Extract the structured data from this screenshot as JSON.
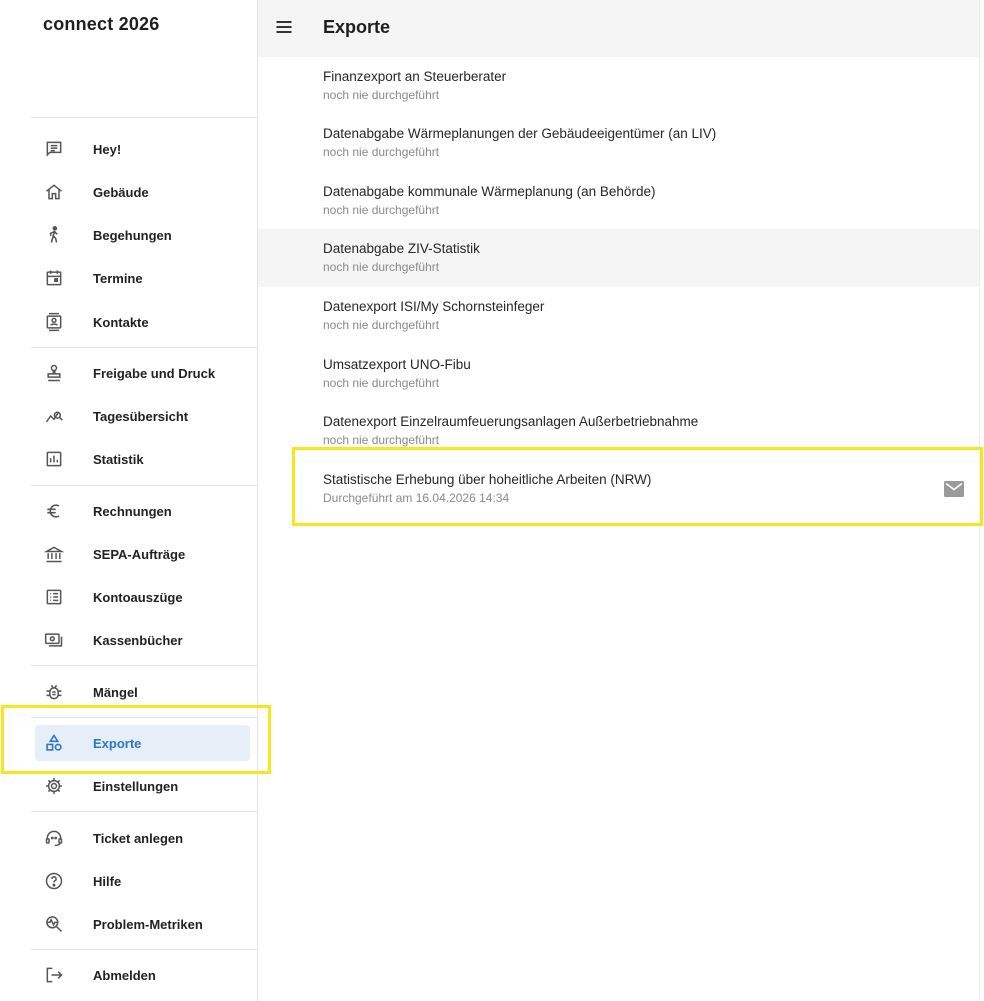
{
  "app": {
    "brand": "connect 2026"
  },
  "header": {
    "title": "Exporte",
    "menu_icon": "menu-icon"
  },
  "sidebar": {
    "items": [
      {
        "label": "Hey!",
        "icon": "message-icon"
      },
      {
        "label": "Gebäude",
        "icon": "home-icon"
      },
      {
        "label": "Begehungen",
        "icon": "walk-icon"
      },
      {
        "label": "Termine",
        "icon": "calendar-icon"
      },
      {
        "label": "Kontakte",
        "icon": "contacts-icon"
      },
      {
        "label": "Freigabe und Druck",
        "icon": "stamp-icon"
      },
      {
        "label": "Tagesübersicht",
        "icon": "query-stats-icon"
      },
      {
        "label": "Statistik",
        "icon": "bar-chart-icon"
      },
      {
        "label": "Rechnungen",
        "icon": "euro-icon"
      },
      {
        "label": "SEPA-Aufträge",
        "icon": "bank-icon"
      },
      {
        "label": "Kontoauszüge",
        "icon": "list-icon"
      },
      {
        "label": "Kassenbücher",
        "icon": "cash-icon"
      },
      {
        "label": "Mängel",
        "icon": "bug-icon"
      },
      {
        "label": "Exporte",
        "icon": "category-icon",
        "active": true
      },
      {
        "label": "Einstellungen",
        "icon": "settings-icon"
      },
      {
        "label": "Ticket anlegen",
        "icon": "support-agent-icon"
      },
      {
        "label": "Hilfe",
        "icon": "help-icon"
      },
      {
        "label": "Problem-Metriken",
        "icon": "troubleshoot-icon"
      },
      {
        "label": "Abmelden",
        "icon": "logout-icon"
      }
    ]
  },
  "exports": [
    {
      "title": "Finanzexport an Steuerberater",
      "status": "noch nie durchgeführt"
    },
    {
      "title": "Datenabgabe Wärmeplanungen der Gebäudeeigentümer (an LIV)",
      "status": "noch nie durchgeführt"
    },
    {
      "title": "Datenabgabe kommunale Wärmeplanung (an Behörde)",
      "status": "noch nie durchgeführt"
    },
    {
      "title": "Datenabgabe ZIV-Statistik",
      "status": "noch nie durchgeführt"
    },
    {
      "title": "Datenexport ISI/My Schornsteinfeger",
      "status": "noch nie durchgeführt"
    },
    {
      "title": "Umsatzexport UNO-Fibu",
      "status": "noch nie durchgeführt"
    },
    {
      "title": "Datenexport Einzelraumfeuerungsanlagen Außerbetriebnahme",
      "status": "noch nie durchgeführt"
    },
    {
      "title": "Statistische Erhebung über hoheitliche Arbeiten (NRW)",
      "status": "Durchgeführt am 16.04.2026 14:34",
      "action_icon": "mail-icon"
    }
  ],
  "colors": {
    "accent": "#2b77c8",
    "active_bg": "#e6eef8",
    "highlight": "#f7e61b",
    "topbar_bg": "#f5f5f5"
  }
}
